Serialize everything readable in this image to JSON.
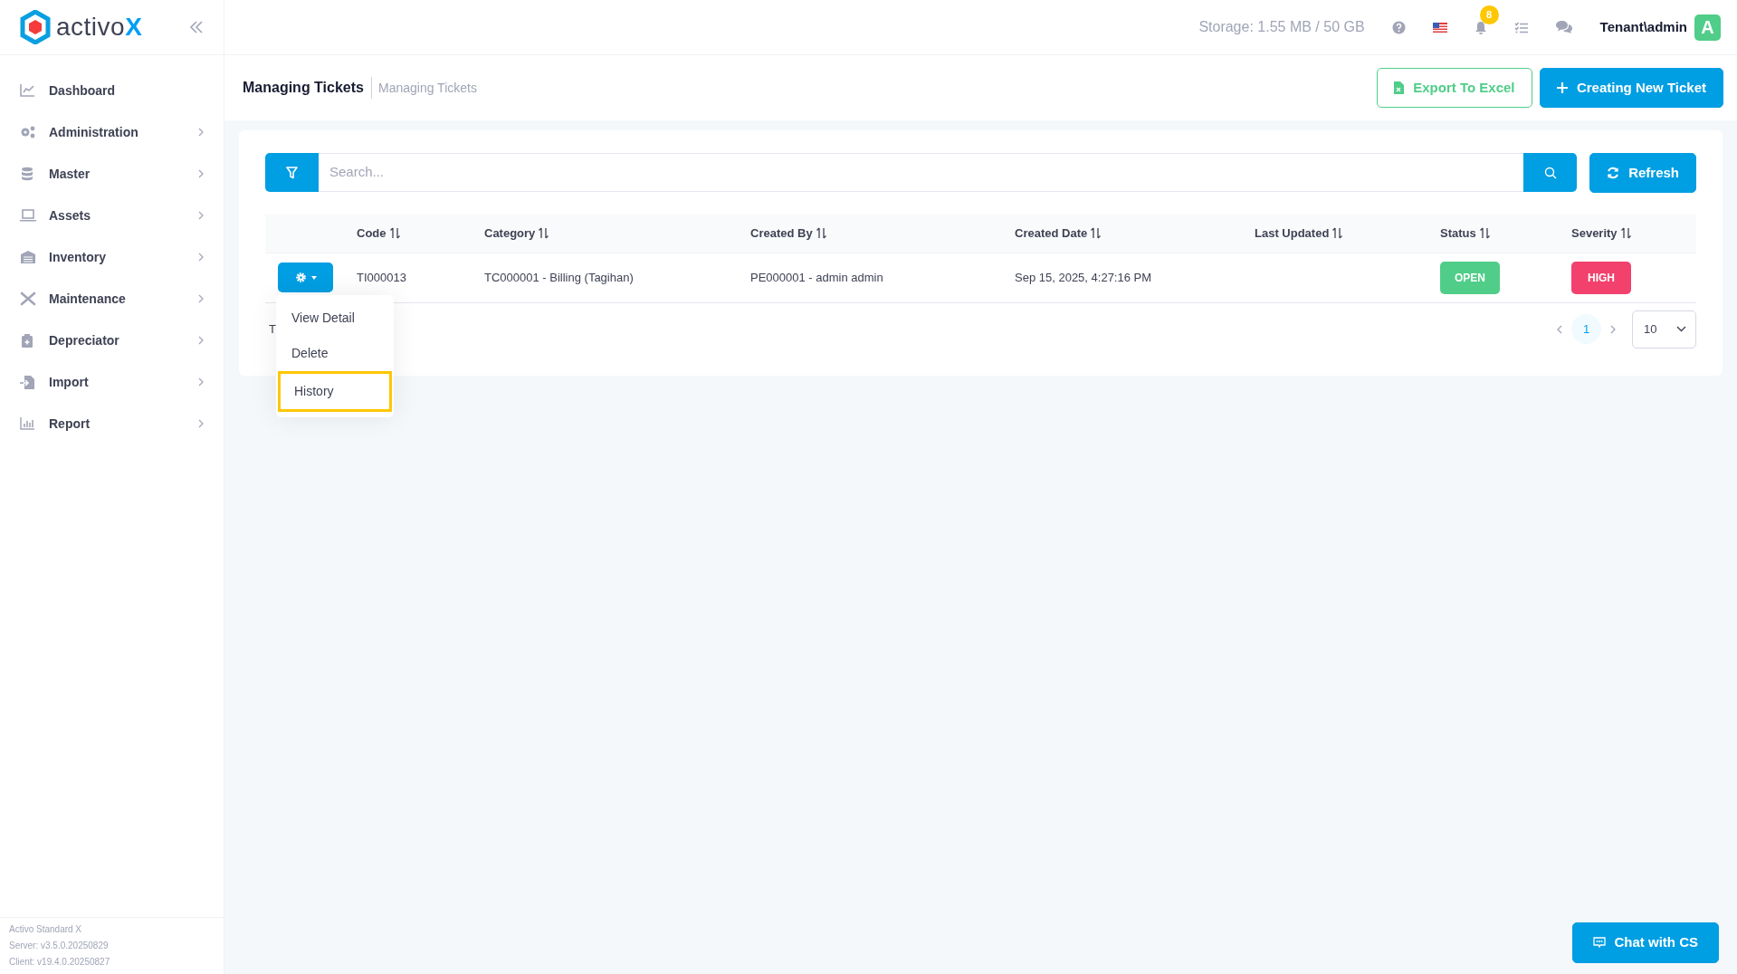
{
  "brand": {
    "name": "activo",
    "mark": "X"
  },
  "sidebar": {
    "items": [
      {
        "label": "Dashboard",
        "has_submenu": false
      },
      {
        "label": "Administration",
        "has_submenu": true
      },
      {
        "label": "Master",
        "has_submenu": true
      },
      {
        "label": "Assets",
        "has_submenu": true
      },
      {
        "label": "Inventory",
        "has_submenu": true
      },
      {
        "label": "Maintenance",
        "has_submenu": true
      },
      {
        "label": "Depreciator",
        "has_submenu": true
      },
      {
        "label": "Import",
        "has_submenu": true
      },
      {
        "label": "Report",
        "has_submenu": true
      }
    ],
    "footer": [
      "Activo Standard X",
      "Server: v3.5.0.20250829",
      "Client: v19.4.0.20250827"
    ]
  },
  "topbar": {
    "storage": "Storage: 1.55 MB / 50 GB",
    "notification_count": "8",
    "user": "Tenant\\admin",
    "avatar": "A"
  },
  "page": {
    "title": "Managing Tickets",
    "breadcrumb": "Managing Tickets",
    "buttons": [
      {
        "label": "Export To Excel",
        "kind": "outline"
      },
      {
        "label": "Creating New Ticket",
        "kind": "primary"
      }
    ]
  },
  "search": {
    "placeholder": "Search...",
    "refresh": "Refresh"
  },
  "table": {
    "columns": [
      "",
      "Code",
      "Category",
      "Created By",
      "Created Date",
      "Last Updated",
      "Status",
      "Severity"
    ],
    "rows": [
      {
        "code": "TI000013",
        "category": "TC000001 - Billing (Tagihan)",
        "created_by": "PE000001 - admin admin",
        "created_date": "Sep 15, 2025, 4:27:16 PM",
        "status": {
          "label": "OPEN",
          "color": "#50cd89"
        },
        "severity": {
          "label": "HIGH",
          "color": "#f1416c"
        }
      }
    ]
  },
  "action_menu": {
    "items": [
      {
        "label": "View Detail",
        "selected": false
      },
      {
        "label": "Delete",
        "selected": false
      },
      {
        "label": "History",
        "selected": true
      }
    ]
  },
  "footer_text": "T",
  "pagination": {
    "pages": [
      {
        "label": "1",
        "selected": true
      }
    ],
    "page_size": "10"
  },
  "chat_button": "Chat with CS"
}
